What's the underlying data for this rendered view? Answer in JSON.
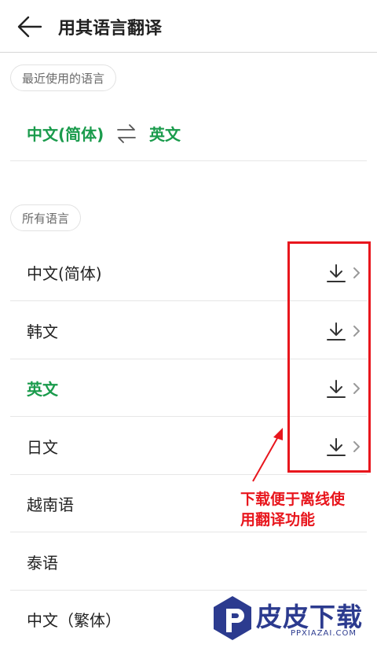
{
  "header": {
    "title": "用其语言翻译",
    "back_icon": "arrow-left-icon"
  },
  "recent": {
    "chip_label": "最近使用的语言",
    "source": "中文(简体)",
    "target": "英文",
    "swap_icon": "swap-arrows-icon"
  },
  "all": {
    "chip_label": "所有语言",
    "items": [
      {
        "label": "中文(简体)",
        "active": false,
        "download": true
      },
      {
        "label": "韩文",
        "active": false,
        "download": true
      },
      {
        "label": "英文",
        "active": true,
        "download": true
      },
      {
        "label": "日文",
        "active": false,
        "download": true
      },
      {
        "label": "越南语",
        "active": false,
        "download": false
      },
      {
        "label": "泰语",
        "active": false,
        "download": false
      },
      {
        "label": "中文（繁体）",
        "active": false,
        "download": false
      }
    ]
  },
  "annotation": {
    "note_line1": "下载便于离线使",
    "note_line2": "用翻译功能",
    "color": "#e8161d"
  },
  "watermark": {
    "text": "皮皮下载",
    "url": "PPXIAZAI.COM"
  },
  "colors": {
    "accent": "#1a9b4c",
    "text": "#222222",
    "chip_text": "#6a6a6a"
  }
}
